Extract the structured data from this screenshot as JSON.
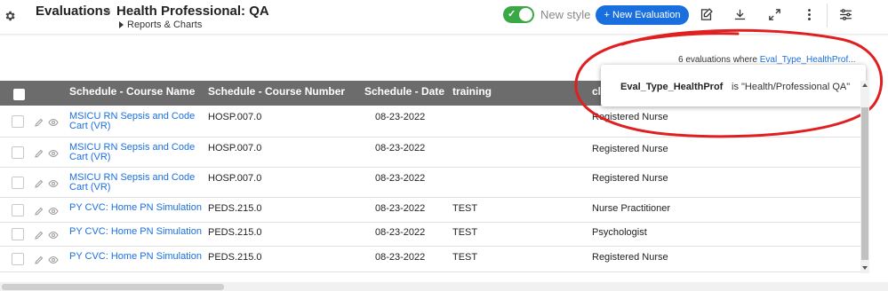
{
  "header": {
    "breadcrumb_root": "Evaluations",
    "separator": ">",
    "title": "Health Professional: QA",
    "sub_link": "Reports & Charts",
    "toggle_label": "New style",
    "new_eval_button": "+ New Evaluation"
  },
  "count": {
    "text": "6 evaluations where",
    "link": "Eval_Type_HealthProf..."
  },
  "popover": {
    "field": "Eval_Type_HealthProf",
    "value": "is \"Health/Professional QA\""
  },
  "table": {
    "columns": [
      "Schedule - Course Name",
      "Schedule - Course Number",
      "Schedule - Date",
      "training",
      "cli"
    ],
    "rows": [
      {
        "course_name": "MSICU RN Sepsis and Code Cart (VR)",
        "course_number": "HOSP.007.0",
        "date": "08-23-2022",
        "training": "",
        "clinician": "Registered Nurse"
      },
      {
        "course_name": "MSICU RN Sepsis and Code Cart (VR)",
        "course_number": "HOSP.007.0",
        "date": "08-23-2022",
        "training": "",
        "clinician": "Registered Nurse"
      },
      {
        "course_name": "MSICU RN Sepsis and Code Cart (VR)",
        "course_number": "HOSP.007.0",
        "date": "08-23-2022",
        "training": "",
        "clinician": "Registered Nurse"
      },
      {
        "course_name": "PY CVC: Home PN Simulation",
        "course_number": "PEDS.215.0",
        "date": "08-23-2022",
        "training": "TEST",
        "clinician": "Nurse Practitioner"
      },
      {
        "course_name": "PY CVC: Home PN Simulation",
        "course_number": "PEDS.215.0",
        "date": "08-23-2022",
        "training": "TEST",
        "clinician": "Psychologist"
      },
      {
        "course_name": "PY CVC: Home PN Simulation",
        "course_number": "PEDS.215.0",
        "date": "08-23-2022",
        "training": "TEST",
        "clinician": "Registered Nurse"
      }
    ]
  },
  "colors": {
    "accent": "#1a6fde",
    "toggle_on": "#3aa845",
    "table_header": "#6c6c6c",
    "annotation": "#e02020"
  },
  "icons": [
    "gear-icon",
    "edit-doc-icon",
    "download-icon",
    "expand-icon",
    "more-vertical-icon",
    "filter-sliders-icon",
    "pencil-icon",
    "eye-icon"
  ]
}
